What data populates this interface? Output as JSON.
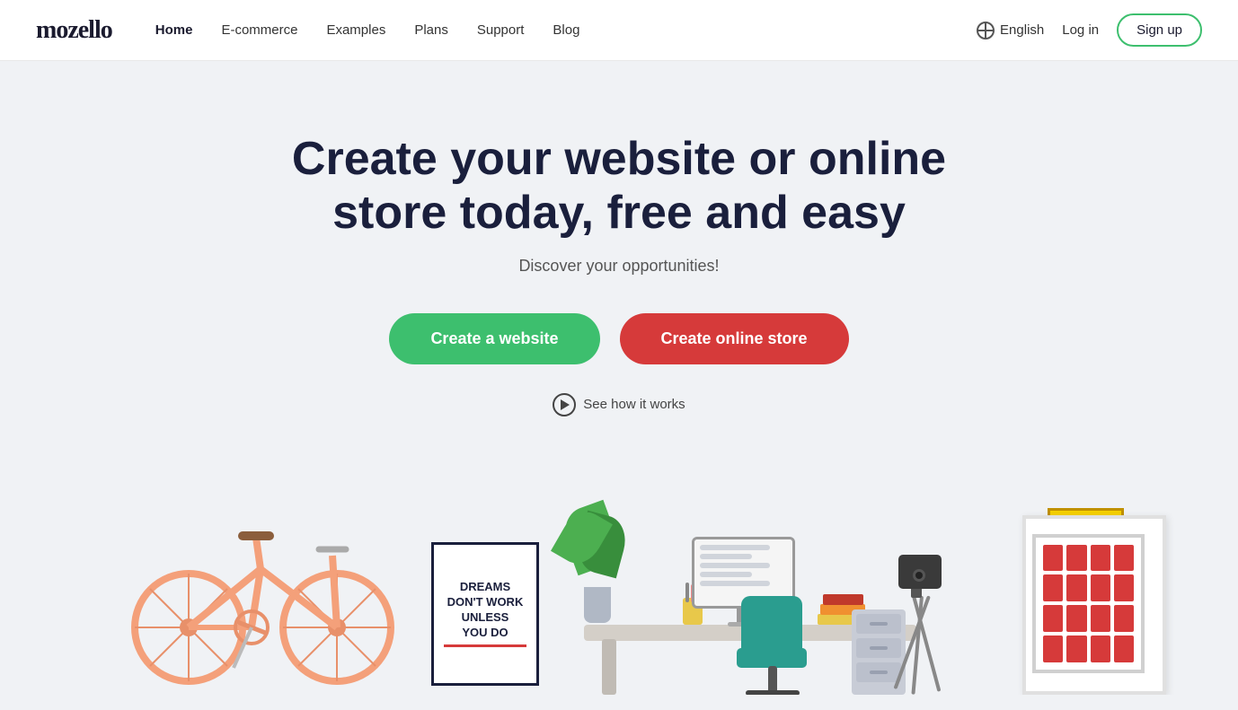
{
  "brand": {
    "logo": "mozello"
  },
  "nav": {
    "links": [
      {
        "label": "Home",
        "active": true
      },
      {
        "label": "E-commerce",
        "active": false
      },
      {
        "label": "Examples",
        "active": false
      },
      {
        "label": "Plans",
        "active": false
      },
      {
        "label": "Support",
        "active": false
      },
      {
        "label": "Blog",
        "active": false
      }
    ],
    "language": "English",
    "login_label": "Log in",
    "signup_label": "Sign up"
  },
  "hero": {
    "title": "Create your website or online store today, free and easy",
    "subtitle": "Discover your opportunities!",
    "cta_website": "Create a website",
    "cta_store": "Create online store",
    "see_how": "See how it works"
  },
  "poster": {
    "line1": "DREAMS",
    "line2": "DON'T WORK",
    "line3": "UNLESS",
    "line4": "YOU DO"
  }
}
